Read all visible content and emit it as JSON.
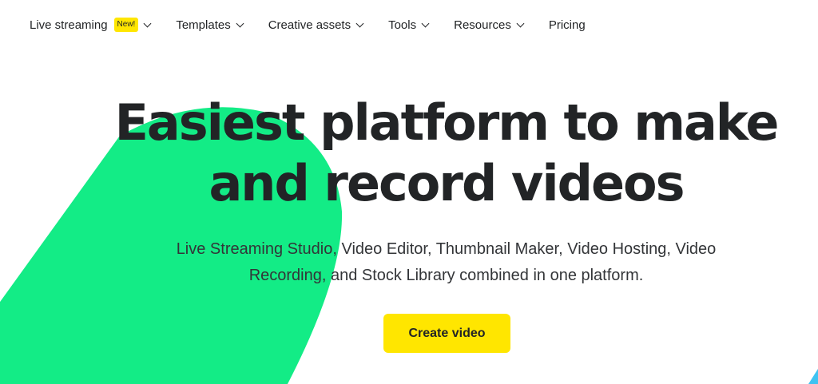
{
  "nav": {
    "items": [
      {
        "label": "Live streaming",
        "badge": "New!"
      },
      {
        "label": "Templates"
      },
      {
        "label": "Creative assets"
      },
      {
        "label": "Tools"
      },
      {
        "label": "Resources"
      },
      {
        "label": "Pricing"
      }
    ]
  },
  "hero": {
    "title_line1": "Easiest platform to make",
    "title_line2": "and record videos",
    "subtitle_line1": "Live Streaming Studio, Video Editor, Thumbnail Maker, Video Hosting, Video",
    "subtitle_line2": "Recording, and Stock Library combined in one platform.",
    "cta_label": "Create video"
  },
  "colors": {
    "accent_green": "#13ec86",
    "accent_yellow": "#ffe600",
    "corner_blue": "#3fc3f2",
    "text": "#222426"
  }
}
